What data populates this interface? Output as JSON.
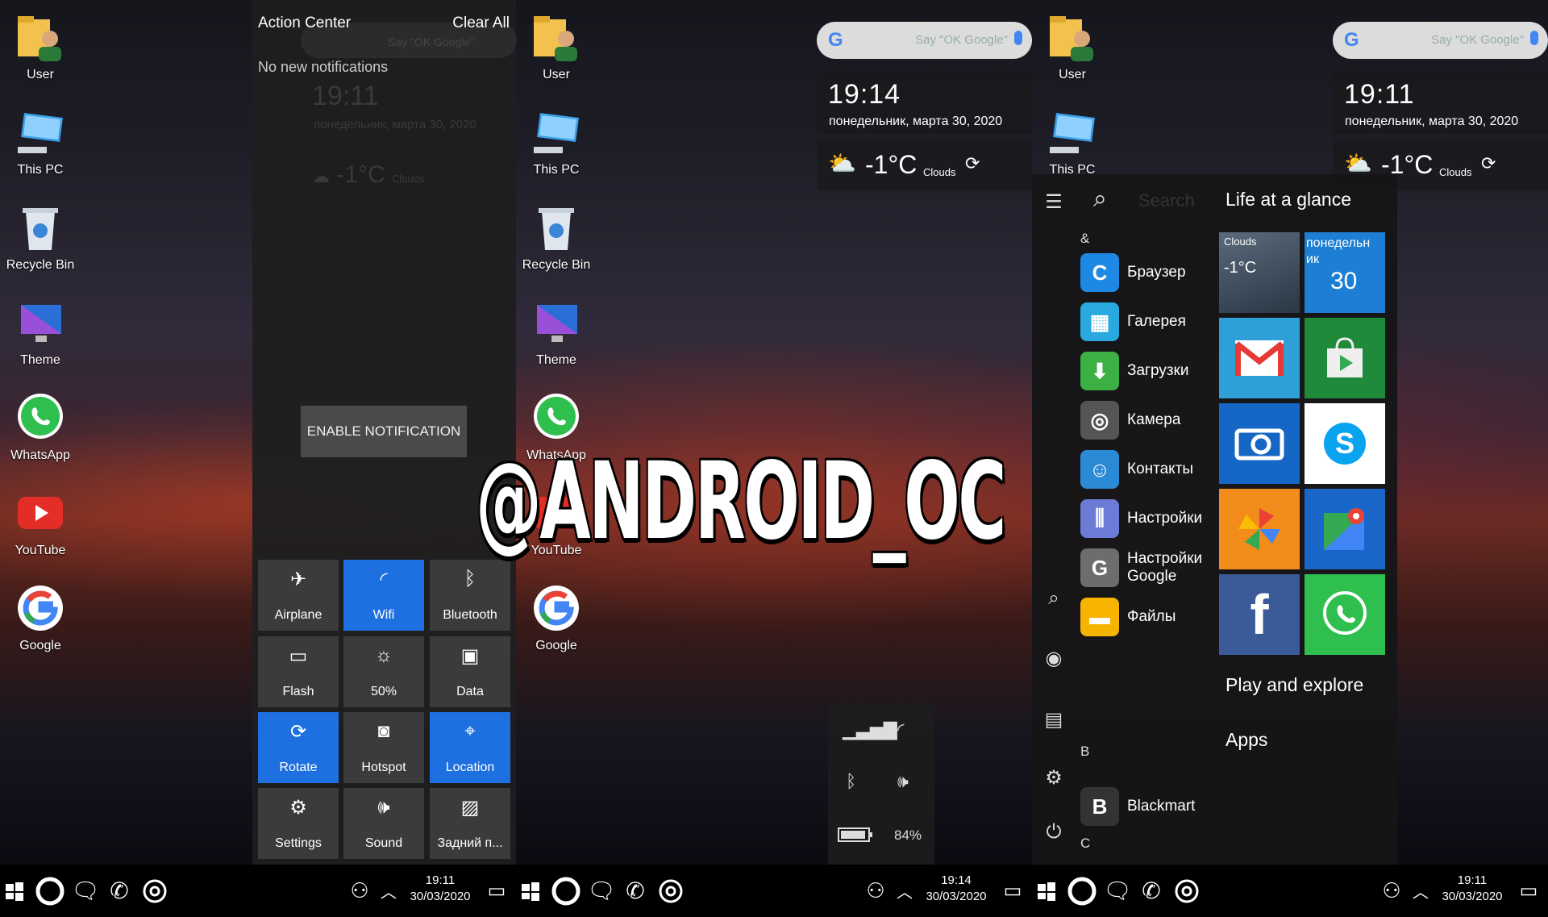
{
  "desktop": {
    "icons": [
      {
        "label": "User"
      },
      {
        "label": "This PC"
      },
      {
        "label": "Recycle Bin"
      },
      {
        "label": "Theme"
      },
      {
        "label": "WhatsApp"
      },
      {
        "label": "YouTube"
      },
      {
        "label": "Google"
      }
    ]
  },
  "action_center": {
    "title": "Action Center",
    "clear_all": "Clear All",
    "no_notifications": "No new notifications",
    "enable_button": "ENABLE NOTIFICATION",
    "ghost_time": "19:11",
    "ghost_date": "понедельник, марта 30, 2020",
    "ghost_temp": "-1°C",
    "ghost_clouds": "Clouds",
    "ghost_search": "Say \"OK Google\"",
    "tiles": [
      {
        "label": "Airplane",
        "icon": "airplane-icon",
        "active": false
      },
      {
        "label": "Wifi",
        "icon": "wifi-icon",
        "active": true
      },
      {
        "label": "Bluetooth",
        "icon": "bluetooth-icon",
        "active": false
      },
      {
        "label": "Flash",
        "icon": "flashlight-icon",
        "active": false
      },
      {
        "label": "50%",
        "icon": "brightness-icon",
        "active": false
      },
      {
        "label": "Data",
        "icon": "data-icon",
        "active": false
      },
      {
        "label": "Rotate",
        "icon": "rotate-icon",
        "active": true
      },
      {
        "label": "Hotspot",
        "icon": "hotspot-icon",
        "active": false
      },
      {
        "label": "Location",
        "icon": "location-icon",
        "active": true
      },
      {
        "label": "Settings",
        "icon": "gear-icon",
        "active": false
      },
      {
        "label": "Sound",
        "icon": "sound-icon",
        "active": false
      },
      {
        "label": "Задний п...",
        "icon": "wallpaper-icon",
        "active": false
      }
    ]
  },
  "widget_middle": {
    "search_placeholder": "Say \"OK Google\"",
    "time": "19:14",
    "date": "понедельник, марта 30, 2020",
    "temp": "-1°C",
    "condition": "Clouds"
  },
  "widget_right": {
    "search_placeholder": "Say \"OK Google\"",
    "time": "19:11",
    "date": "понедельник, марта 30, 2020",
    "temp": "-1°C",
    "condition": "Clouds"
  },
  "status_popup": {
    "battery": "84%"
  },
  "start_menu": {
    "search_placeholder": "Search",
    "group_amp": "&",
    "apps": [
      {
        "name": "Браузер",
        "color": "#1e88e5"
      },
      {
        "name": "Галерея",
        "color": "#29a9e0"
      },
      {
        "name": "Загрузки",
        "color": "#3cb043"
      },
      {
        "name": "Камера",
        "color": "#555555"
      },
      {
        "name": "Контакты",
        "color": "#2b8ad6"
      },
      {
        "name": "Настройки",
        "color": "#6b7bd6"
      },
      {
        "name": "Настройки Google",
        "color": "#6d6d6d"
      },
      {
        "name": "Файлы",
        "color": "#f6b400"
      }
    ],
    "group_b": "B",
    "app_b": "Blackmart",
    "group_c": "C",
    "life_title": "Life at a glance",
    "weather_tile": {
      "condition": "Clouds",
      "temp": "-1°C"
    },
    "calendar_tile": {
      "day_name": "понедельн ик",
      "day": "30"
    },
    "tile_colors": {
      "gmail": "#2f9fd8",
      "play": "#1e8a3a",
      "camera": "#1666c5",
      "skype": "#ffffff",
      "photos": "#f28c1a",
      "maps": "#1a66c8",
      "facebook": "#3a5a99",
      "whatsapp": "#2fbf4e"
    },
    "play_title": "Play and explore",
    "apps_title": "Apps"
  },
  "taskbars": [
    {
      "time": "19:11",
      "date": "30/03/2020"
    },
    {
      "time": "19:14",
      "date": "30/03/2020"
    },
    {
      "time": "19:11",
      "date": "30/03/2020"
    }
  ],
  "watermark": "@ANDROID_OC"
}
